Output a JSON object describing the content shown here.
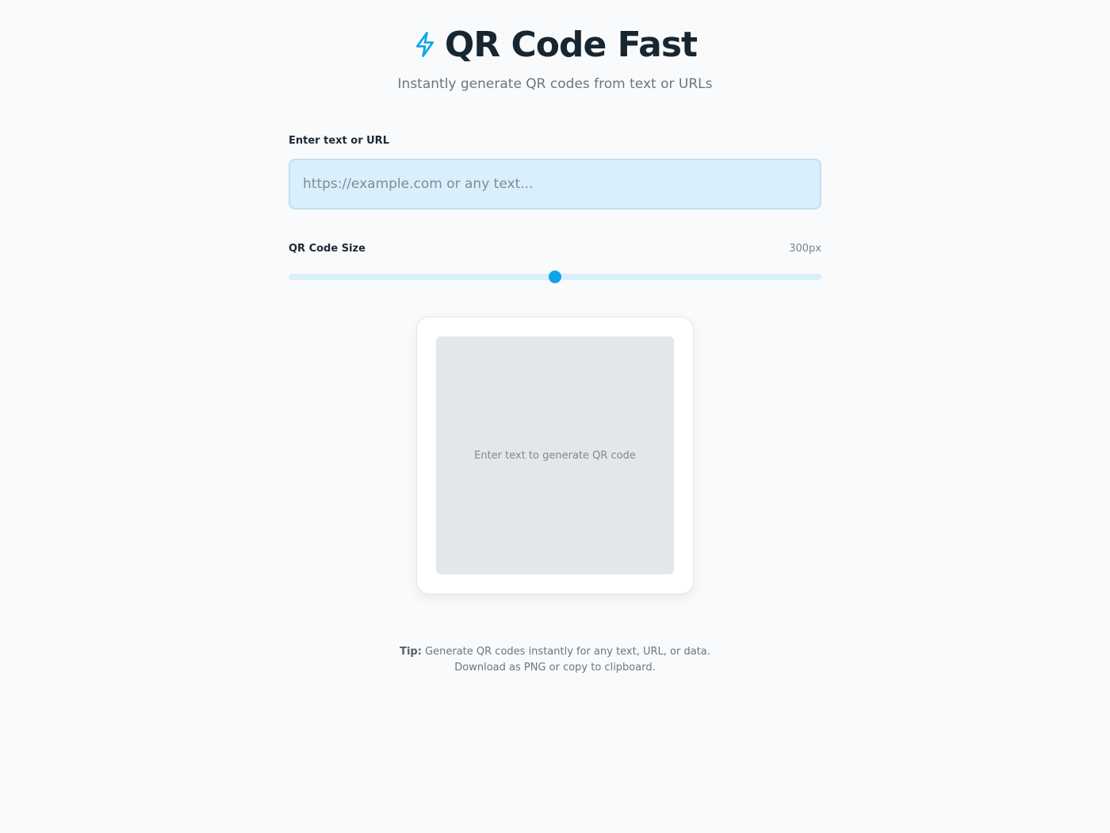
{
  "header": {
    "icon": "lightning-bolt-icon",
    "title": "QR Code Fast",
    "subtitle": "Instantly generate QR codes from text or URLs"
  },
  "input": {
    "label": "Enter text or URL",
    "placeholder": "https://example.com or any text...",
    "value": ""
  },
  "size": {
    "label": "QR Code Size",
    "value_text": "300px",
    "slider_fraction": 0.5
  },
  "preview": {
    "placeholder_text": "Enter text to generate QR code"
  },
  "tip": {
    "icon": "",
    "label": "Tip:",
    "line1": "Generate QR codes instantly for any text, URL, or data.",
    "line2": "Download as PNG or copy to clipboard."
  },
  "colors": {
    "accent": "#0ea5e9",
    "input_bg": "#d9effb"
  }
}
